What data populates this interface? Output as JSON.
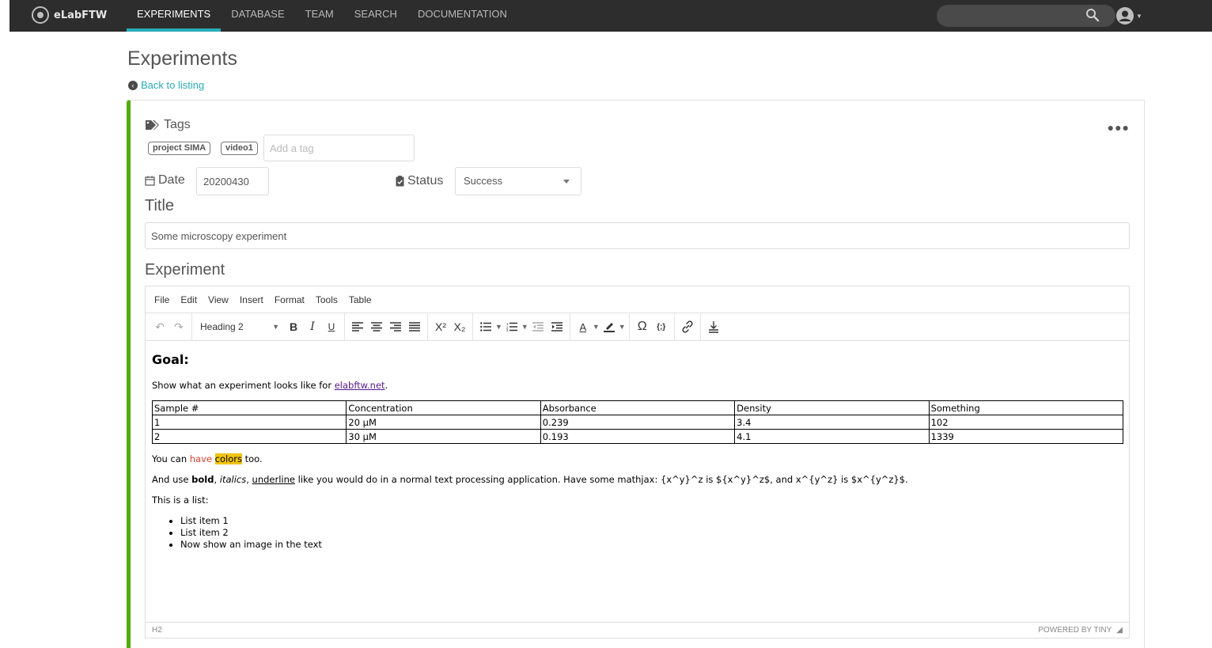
{
  "nav": {
    "brand": "eLabFTW",
    "links": [
      "EXPERIMENTS",
      "DATABASE",
      "TEAM",
      "SEARCH",
      "DOCUMENTATION"
    ],
    "active_index": 0,
    "search_placeholder": ""
  },
  "page": {
    "title": "Experiments",
    "back_link": "Back to listing"
  },
  "tags": {
    "label": "Tags",
    "items": [
      "project SIMA",
      "video1"
    ],
    "input_placeholder": "Add a tag"
  },
  "date": {
    "label": "Date",
    "value": "20200430"
  },
  "status": {
    "label": "Status",
    "selected": "Success"
  },
  "title_section": {
    "label": "Title",
    "value": "Some microscopy experiment"
  },
  "experiment": {
    "label": "Experiment",
    "menu": [
      "File",
      "Edit",
      "View",
      "Insert",
      "Format",
      "Tools",
      "Table"
    ],
    "block_format": "Heading 2",
    "content": {
      "heading": "Goal:",
      "intro_text": "Show what an experiment looks like for ",
      "intro_link": "elabftw.net",
      "intro_end": ".",
      "table": [
        [
          "Sample #",
          "Concentration",
          "Absorbance",
          "Density",
          "Something"
        ],
        [
          "1",
          "20 µM",
          "0.239",
          "3.4",
          "102"
        ],
        [
          "2",
          "30 µM",
          "0.193",
          "4.1",
          "1339"
        ]
      ],
      "colors_prefix": "You can ",
      "colors_red": "have",
      "colors_space": " ",
      "colors_highlight": "colors",
      "colors_suffix": " too.",
      "style_prefix": "And use ",
      "style_bold": "bold",
      "style_comma1": ", ",
      "style_italic": "italics",
      "style_comma2": ", ",
      "style_underline": "underline",
      "style_suffix": " like you would do in a normal text processing application. Have some mathjax:   {x^y}^z is ${x^y}^z$, and x^{y^z} is $x^{y^z}$.",
      "list_intro": "This is a list:",
      "list_items": [
        "List item 1",
        "List item 2",
        "Now show an image in the text"
      ]
    },
    "statusbar_path": "H2",
    "powered_by": "POWERED BY TINY"
  },
  "colors": {
    "nav_bg": "#2d2d2d",
    "accent": "#29aeb9",
    "status_success": "#54aa08",
    "text_red": "#e03e2d",
    "highlight_yellow": "#f1c40f"
  }
}
